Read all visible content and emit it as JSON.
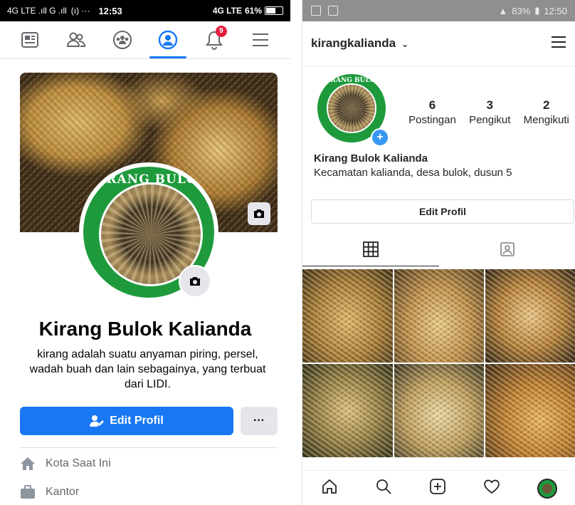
{
  "facebook": {
    "status_bar": {
      "left": "4G LTE .ıll G .ıll",
      "extra": "(ı) ···",
      "time": "12:53",
      "network": "4G LTE",
      "battery": "61%"
    },
    "nav": {
      "notification_count": "9"
    },
    "profile": {
      "cover_logo_text": "KIRANG BULOK",
      "name": "Kirang Bulok Kalianda",
      "bio": "kirang adalah suatu anyaman piring, persel, wadah buah dan lain sebagainya, yang terbuat dari LIDI."
    },
    "actions": {
      "edit_label": "Edit Profil",
      "more_label": "···"
    },
    "info": [
      {
        "label": "Kota Saat Ini"
      },
      {
        "label": "Kantor"
      }
    ]
  },
  "instagram": {
    "status_bar": {
      "signal": "83%",
      "time": "12:50"
    },
    "header": {
      "username": "kirangkalianda",
      "caret": "⌄"
    },
    "avatar_logo_text": "KIRANG BULOK",
    "stats": [
      {
        "number": "6",
        "label": "Postingan"
      },
      {
        "number": "3",
        "label": "Pengikut"
      },
      {
        "number": "2",
        "label": "Mengikuti"
      }
    ],
    "full_name": "Kirang Bulok Kalianda",
    "bio": "Kecamatan kalianda, desa bulok, dusun 5",
    "edit_label": "Edit Profil"
  },
  "colors": {
    "fb_blue": "#1877f2",
    "ig_blue": "#3897f0",
    "badge_red": "#e41e3f",
    "logo_green": "#1e9a3c"
  }
}
